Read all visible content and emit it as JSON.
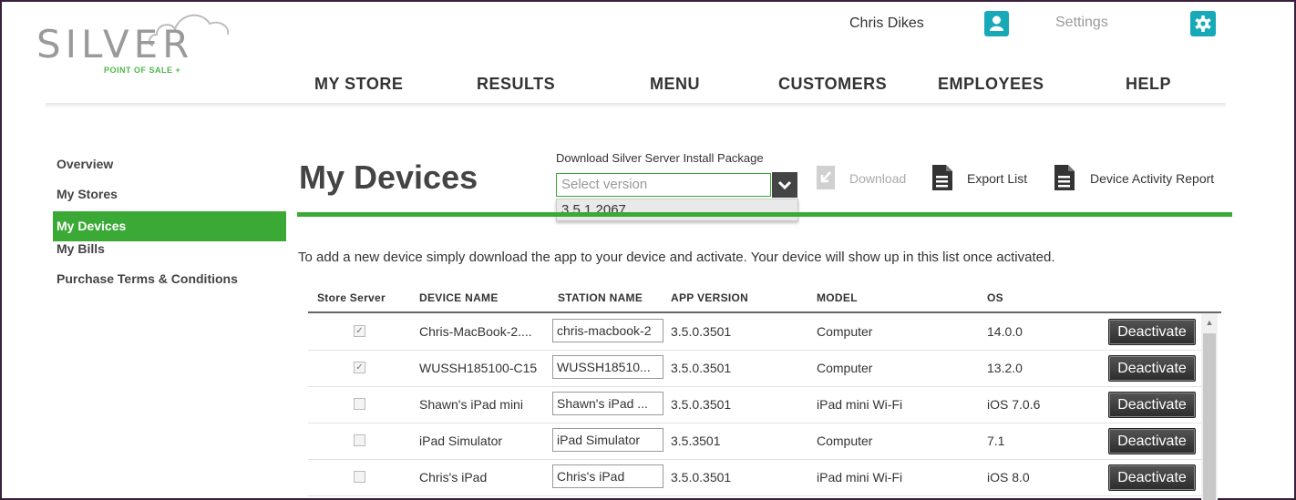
{
  "brand": {
    "name": "SILVER",
    "tagline": "POINT OF SALE +",
    "accent": "#3aa935",
    "teal": "#17a9b8"
  },
  "header": {
    "user_name": "Chris Dikes",
    "user_icon": "user-icon",
    "settings_label": "Settings",
    "settings_icon": "gear-icon"
  },
  "nav": [
    "MY STORE",
    "RESULTS",
    "MENU",
    "CUSTOMERS",
    "EMPLOYEES",
    "HELP"
  ],
  "sidebar": {
    "items": [
      {
        "label": "Overview",
        "active": false
      },
      {
        "label": "My Stores",
        "active": false
      },
      {
        "label": "My Devices",
        "active": true
      },
      {
        "label": "My Bills",
        "active": false
      },
      {
        "label": "Purchase Terms & Conditions",
        "active": false
      }
    ]
  },
  "page": {
    "title": "My Devices",
    "download_label": "Download Silver Server Install Package",
    "select_placeholder": "Select version",
    "dropdown_options": [
      "3.5.1.2067"
    ],
    "download_button": "Download",
    "export_button": "Export List",
    "report_button": "Device Activity Report",
    "intro": "To add a new device simply download the app to your device and activate. Your device will show up in this list once activated."
  },
  "table": {
    "headers": [
      "Store Server",
      "DEVICE NAME",
      "STATION NAME",
      "APP VERSION",
      "MODEL",
      "OS"
    ],
    "rows": [
      {
        "checked": true,
        "device": "Chris-MacBook-2....",
        "station": "chris-macbook-2",
        "version": "3.5.0.3501",
        "model": "Computer",
        "os": "14.0.0",
        "action": "Deactivate"
      },
      {
        "checked": true,
        "device": "WUSSH185100-C15",
        "station": "WUSSH18510...",
        "version": "3.5.0.3501",
        "model": "Computer",
        "os": "13.2.0",
        "action": "Deactivate"
      },
      {
        "checked": false,
        "device": "Shawn's iPad mini",
        "station": "Shawn's iPad ...",
        "version": "3.5.0.3501",
        "model": "iPad mini Wi-Fi",
        "os": "iOS 7.0.6",
        "action": "Deactivate"
      },
      {
        "checked": false,
        "device": "iPad Simulator",
        "station": "iPad Simulator",
        "version": "3.5.3501",
        "model": "Computer",
        "os": "7.1",
        "action": "Deactivate"
      },
      {
        "checked": false,
        "device": "Chris's iPad",
        "station": "Chris's iPad",
        "version": "3.5.0.3501",
        "model": "iPad mini Wi-Fi",
        "os": "iOS 8.0",
        "action": "Deactivate"
      }
    ]
  }
}
